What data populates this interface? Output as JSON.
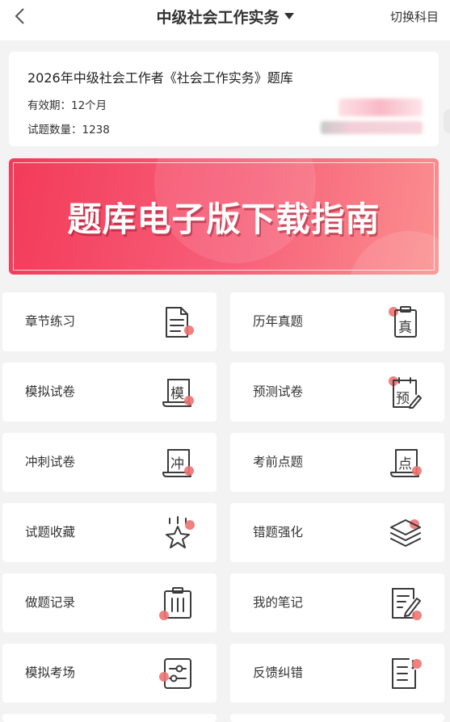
{
  "header": {
    "title": "中级社会工作实务",
    "switch_label": "切换科目"
  },
  "info": {
    "bank_name": "2026年中级社会工作者《社会工作实务》题库",
    "validity": "有效期：12个月",
    "count": "试题数量：1238"
  },
  "banner": {
    "text": "题库电子版下载指南"
  },
  "menu": [
    {
      "label": "章节练习",
      "icon": "document-list-icon"
    },
    {
      "label": "历年真题",
      "icon": "clipboard-zhen-icon",
      "glyph": "真"
    },
    {
      "label": "模拟试卷",
      "icon": "scroll-mo-icon",
      "glyph": "模"
    },
    {
      "label": "预测试卷",
      "icon": "calendar-yu-icon",
      "glyph": "预"
    },
    {
      "label": "冲刺试卷",
      "icon": "scroll-chong-icon",
      "glyph": "冲"
    },
    {
      "label": "考前点题",
      "icon": "scroll-dian-icon",
      "glyph": "点"
    },
    {
      "label": "试题收藏",
      "icon": "star-icon"
    },
    {
      "label": "错题强化",
      "icon": "layers-icon"
    },
    {
      "label": "做题记录",
      "icon": "clipboard-record-icon"
    },
    {
      "label": "我的笔记",
      "icon": "note-pencil-icon"
    },
    {
      "label": "模拟考场",
      "icon": "sliders-icon"
    },
    {
      "label": "反馈纠错",
      "icon": "feedback-list-icon"
    }
  ]
}
